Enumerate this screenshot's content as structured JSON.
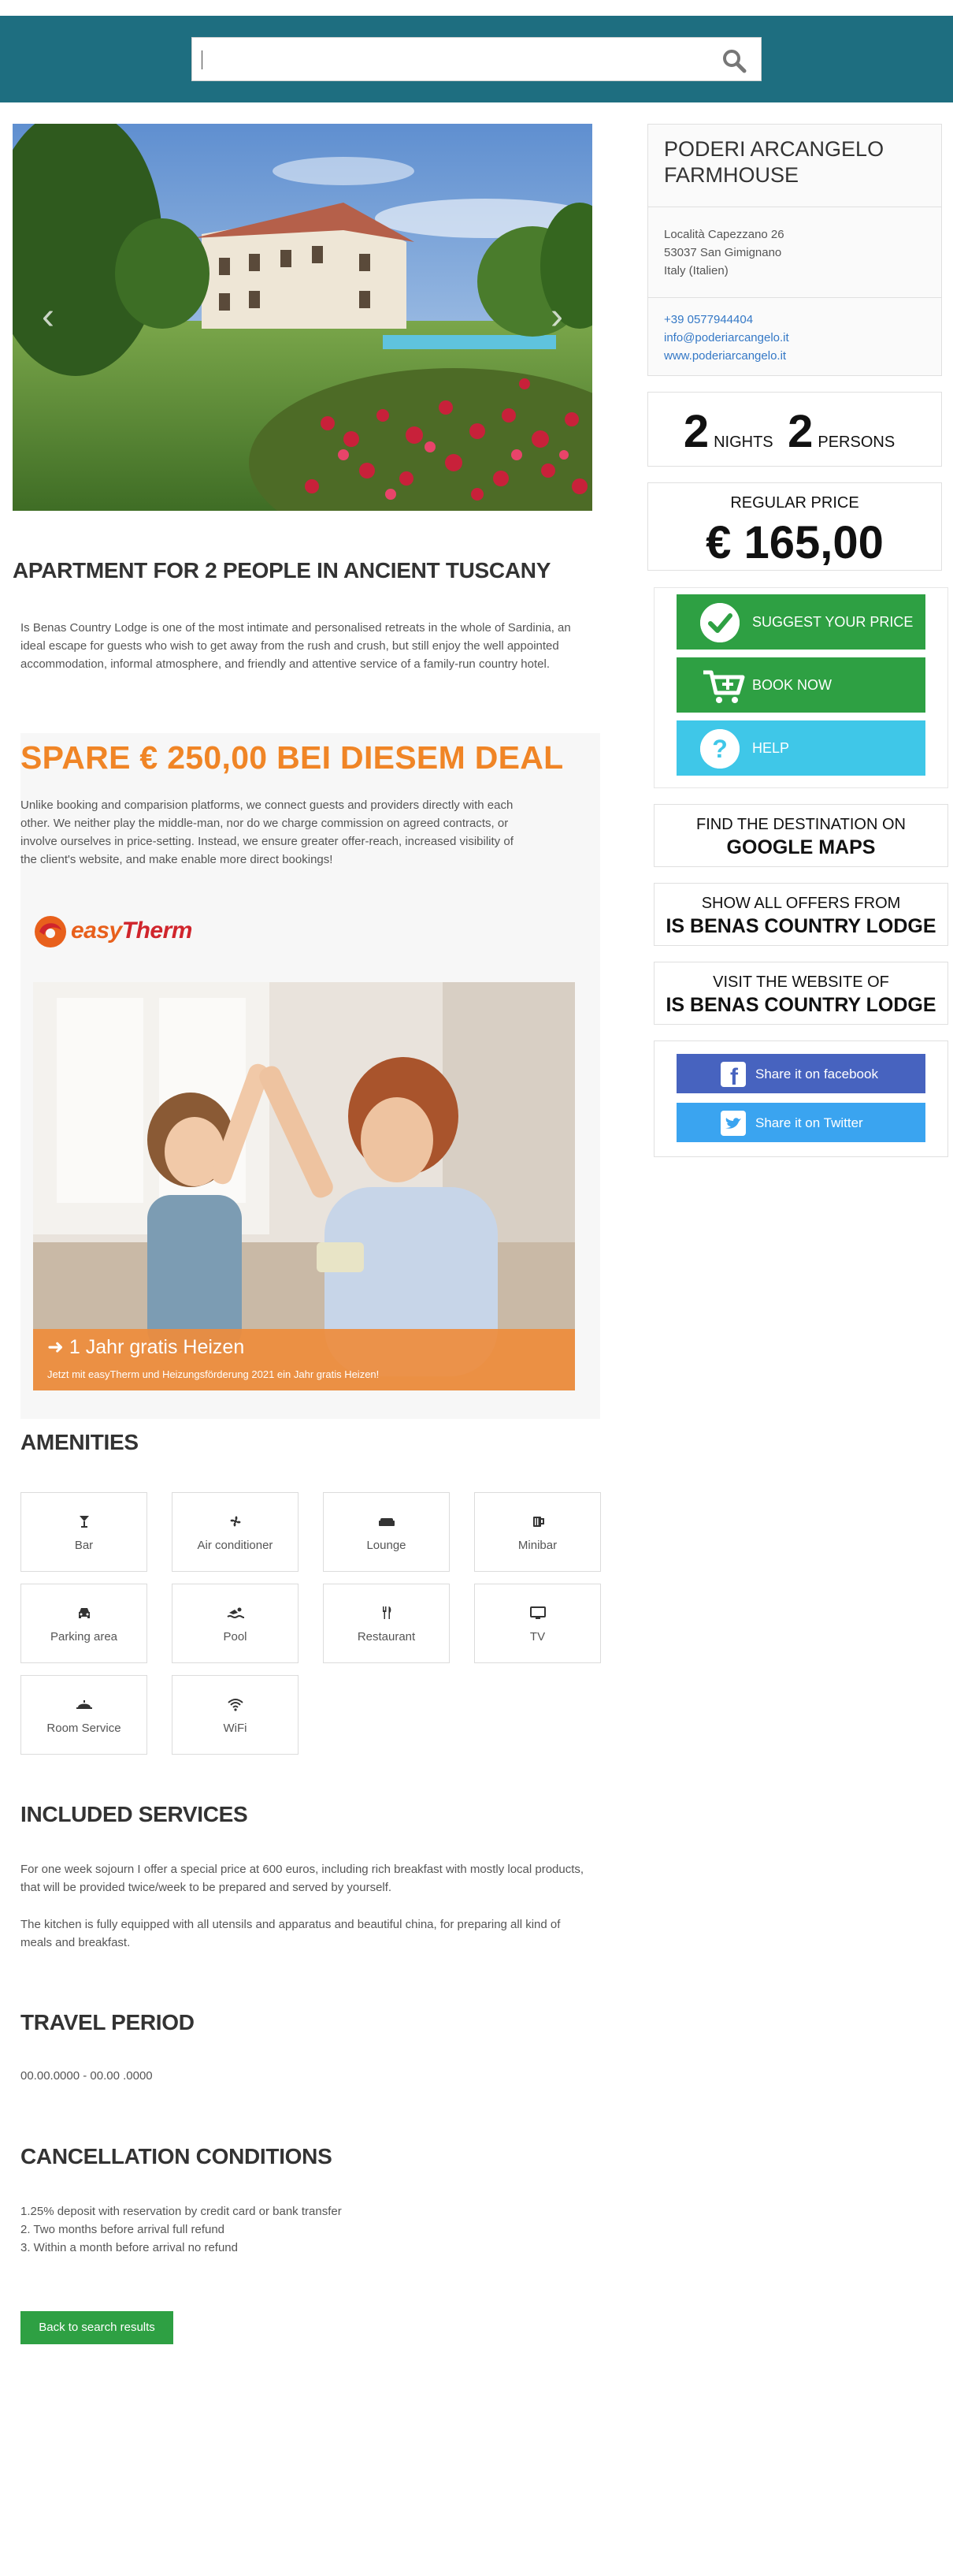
{
  "search": {
    "placeholder": "",
    "value": ""
  },
  "listing": {
    "title": "APARTMENT FOR 2 PEOPLE IN ANCIENT TUSCANY",
    "intro": "Is Benas Country Lodge is one of the most intimate and personalised retreats in the whole of Sardinia, an ideal escape for guests who wish to get away from the rush and crush, but still enjoy the well appointed accommodation, informal atmosphere, and friendly and attentive service of a family-run country hotel."
  },
  "deal": {
    "title": "SPARE € 250,00 BEI DIESEM DEAL",
    "text": "Unlike booking and comparision platforms, we connect guests and providers directly with each other. We neither play the middle-man, nor do we charge commission on agreed contracts, or involve ourselves in price-setting. Instead, we ensure greater offer-reach, increased visibility of the client's website, and make enable more direct bookings!",
    "logo_part1": "easy",
    "logo_part2": "Therm",
    "banner_title": "1 Jahr gratis Heizen",
    "banner_sub": "Jetzt mit easyTherm und Heizungsförderung 2021 ein Jahr gratis Heizen!"
  },
  "amenities": {
    "title": "AMENITIES",
    "items": [
      {
        "label": "Bar",
        "icon": "bar-icon"
      },
      {
        "label": "Air conditioner",
        "icon": "fan-icon"
      },
      {
        "label": "Lounge",
        "icon": "sofa-icon"
      },
      {
        "label": "Minibar",
        "icon": "mug-icon"
      },
      {
        "label": "Parking area",
        "icon": "car-icon"
      },
      {
        "label": "Pool",
        "icon": "swimmer-icon"
      },
      {
        "label": "Restaurant",
        "icon": "cutlery-icon"
      },
      {
        "label": "TV",
        "icon": "monitor-icon"
      },
      {
        "label": "Room Service",
        "icon": "bell-icon"
      },
      {
        "label": "WiFi",
        "icon": "wifi-icon"
      }
    ]
  },
  "included": {
    "title": "INCLUDED SERVICES",
    "p1": "For one week sojourn I offer a special price at 600 euros, including rich breakfast with mostly local products, that will be provided twice/week to be prepared and served by yourself.",
    "p2": "The kitchen is fully equipped with all utensils and apparatus and beautiful china, for preparing all kind of meals and breakfast."
  },
  "travel": {
    "title": "TRAVEL PERIOD",
    "value": "00.00.0000 - 00.00 .0000"
  },
  "cancellation": {
    "title": "CANCELLATION CONDITIONS",
    "lines": [
      "1.25% deposit with reservation by credit card or bank transfer",
      "2. Two months before arrival full refund",
      "3. Within a month before arrival no refund"
    ]
  },
  "back_button": "Back to search results",
  "sidebar": {
    "name": "PODERI ARCANGELO FARMHOUSE",
    "address": [
      "Località Capezzano 26",
      "53037 San Gimignano",
      "Italy (Italien)"
    ],
    "phone": "+39 0577944404",
    "email": "info@poderiarcangelo.it",
    "website": "www.poderiarcangelo.it",
    "nights": "2",
    "nights_label": "NIGHTS",
    "persons": "2",
    "persons_label": "PERSONS",
    "regular_price_label": "REGULAR PRICE",
    "regular_price": "€ 165,00",
    "suggest_label": "SUGGEST YOUR PRICE",
    "book_label": "BOOK NOW",
    "help_label": "HELP",
    "maps_l1": "FIND THE DESTINATION ON",
    "maps_l2": "GOOGLE MAPS",
    "offers_l1": "SHOW ALL OFFERS FROM",
    "offers_l2": "IS BENAS COUNTRY LODGE",
    "website_l1": "VISIT THE WEBSITE OF",
    "website_l2": "IS BENAS COUNTRY LODGE",
    "facebook_label": "Share it on facebook",
    "twitter_label": "Share it on Twitter"
  },
  "colors": {
    "header": "#1e6e80",
    "green": "#2ea043",
    "help": "#3fc7e8",
    "facebook": "#4763bf",
    "twitter": "#3aa4f0",
    "orange": "#f08526"
  }
}
